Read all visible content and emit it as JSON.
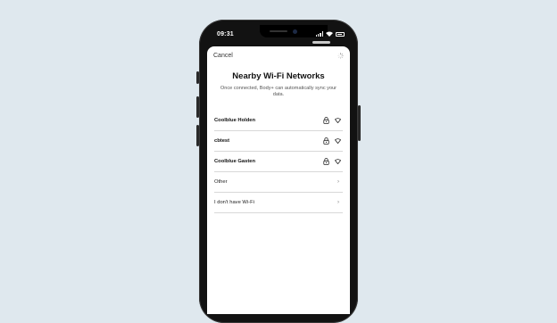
{
  "status_bar": {
    "time": "09:31"
  },
  "sheet": {
    "cancel_label": "Cancel",
    "title": "Nearby Wi-Fi Networks",
    "subtitle": "Once connected, Body+ can automatically sync your data."
  },
  "networks": [
    {
      "name": "Coolblue Holden",
      "icons": [
        "lock-icon",
        "wifi-signal-icon"
      ]
    },
    {
      "name": "cbtest",
      "icons": [
        "lock-icon",
        "wifi-signal-icon"
      ]
    },
    {
      "name": "Coolblue Gasten",
      "icons": [
        "lock-icon",
        "wifi-signal-icon"
      ]
    }
  ],
  "options": [
    {
      "label": "Other",
      "icon": "chevron-right-icon"
    },
    {
      "label": "I don't have Wi-Fi",
      "icon": "chevron-right-icon"
    }
  ],
  "colors": {
    "background": "#dfe8ee",
    "phone": "#121212",
    "sheet": "#ffffff"
  }
}
